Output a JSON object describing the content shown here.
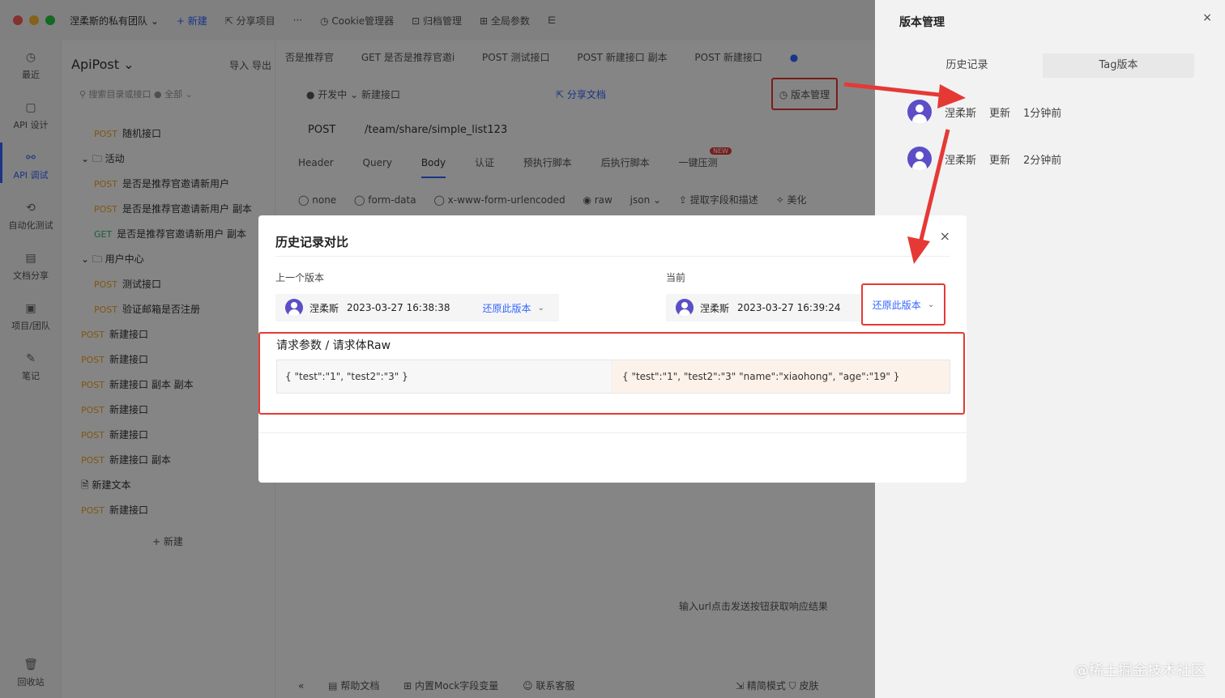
{
  "titlebar": {
    "team": "涅柔斯的私有团队 ⌄",
    "items": [
      "+ 新建",
      "⇱ 分享项目",
      "···",
      "◷ Cookie管理器",
      "⊡ 归档管理",
      "⊞ 全局参数",
      "⋿"
    ]
  },
  "nav": [
    "最近",
    "API 设计",
    "API 调试",
    "自动化测试",
    "文档分享",
    "项目/团队",
    "笔记",
    "回收站"
  ],
  "tree": {
    "project": "ApiPost ⌄",
    "actions": "导入  导出",
    "search": "⚲ 搜索目录或接口   ● 全部 ⌄",
    "rows": [
      {
        "method": "POST",
        "name": "随机接口"
      },
      {
        "method": "",
        "name": "⌄ 🗀 活动"
      },
      {
        "method": "POST",
        "name": "是否是推荐官邀请新用户"
      },
      {
        "method": "POST",
        "name": "是否是推荐官邀请新用户 副本"
      },
      {
        "method": "GET",
        "name": "是否是推荐官邀请新用户 副本"
      },
      {
        "method": "",
        "name": "⌄ 🗀 用户中心"
      },
      {
        "method": "POST",
        "name": "测试接口"
      },
      {
        "method": "POST",
        "name": "验证邮箱是否注册"
      },
      {
        "method": "POST",
        "name": "新建接口"
      },
      {
        "method": "POST",
        "name": "新建接口"
      },
      {
        "method": "POST",
        "name": "新建接口 副本 副本"
      },
      {
        "method": "POST",
        "name": "新建接口"
      },
      {
        "method": "POST",
        "name": "新建接口"
      },
      {
        "method": "POST",
        "name": "新建接口 副本"
      },
      {
        "method": "",
        "name": "🗎 新建文本"
      },
      {
        "method": "POST",
        "name": "新建接口"
      }
    ],
    "new_label": "+ 新建"
  },
  "main": {
    "tabs": [
      "否是推荐官",
      "GET 是否是推荐官邀i",
      "POST 测试接口",
      "POST 新建接口 副本",
      "POST 新建接口",
      "●"
    ],
    "env": "● 开发中 ⌄     新建接口",
    "share_doc": "⇱ 分享文档",
    "version_btn": "◷ 版本管理",
    "method": "POST",
    "url": "/team/share/simple_list123",
    "req_tabs": [
      "Header",
      "Query",
      "Body",
      "认证",
      "预执行脚本",
      "后执行脚本",
      "一键压测"
    ],
    "new_badge": "NEW",
    "body_types": [
      "◯ none",
      "◯ form-data",
      "◯ x-www-form-urlencoded",
      "◉ raw",
      "json ⌄",
      "⇪ 提取字段和描述",
      "✧ 美化"
    ],
    "empty_msg": "输入url点击发送按钮获取响应结果",
    "bottom": [
      "«",
      "▤ 帮助文档",
      "⊞ 内置Mock字段变量",
      "☺ 联系客服"
    ],
    "bottom_right": "⇲ 精简模式     ⛉ 皮肤"
  },
  "panel": {
    "title": "版本管理",
    "close": "×",
    "tabs": [
      "历史记录",
      "Tag版本"
    ],
    "history": [
      {
        "user": "涅柔斯",
        "action": "更新",
        "time": "1分钟前"
      },
      {
        "user": "涅柔斯",
        "action": "更新",
        "time": "2分钟前"
      }
    ]
  },
  "modal": {
    "title": "历史记录对比",
    "close": "×",
    "prev_label": "上一个版本",
    "curr_label": "当前",
    "prev": {
      "user": "涅柔斯",
      "time": "2023-03-27 16:38:38",
      "restore": "还原此版本"
    },
    "curr": {
      "user": "涅柔斯",
      "time": "2023-03-27 16:39:24",
      "restore": "还原此版本"
    },
    "diff_title": "请求参数 / 请求体Raw",
    "diff_left": "{ \"test\":\"1\", \"test2\":\"3\" }",
    "diff_right": "{ \"test\":\"1\", \"test2\":\"3\" \"name\":\"xiaohong\", \"age\":\"19\" }"
  },
  "watermark": "@稀土掘金技术社区",
  "colors": {
    "accent": "#3366ff",
    "highlight": "#e53935",
    "avatar": "#5b4ec6",
    "post": "#f5a623",
    "get": "#2bb673"
  }
}
